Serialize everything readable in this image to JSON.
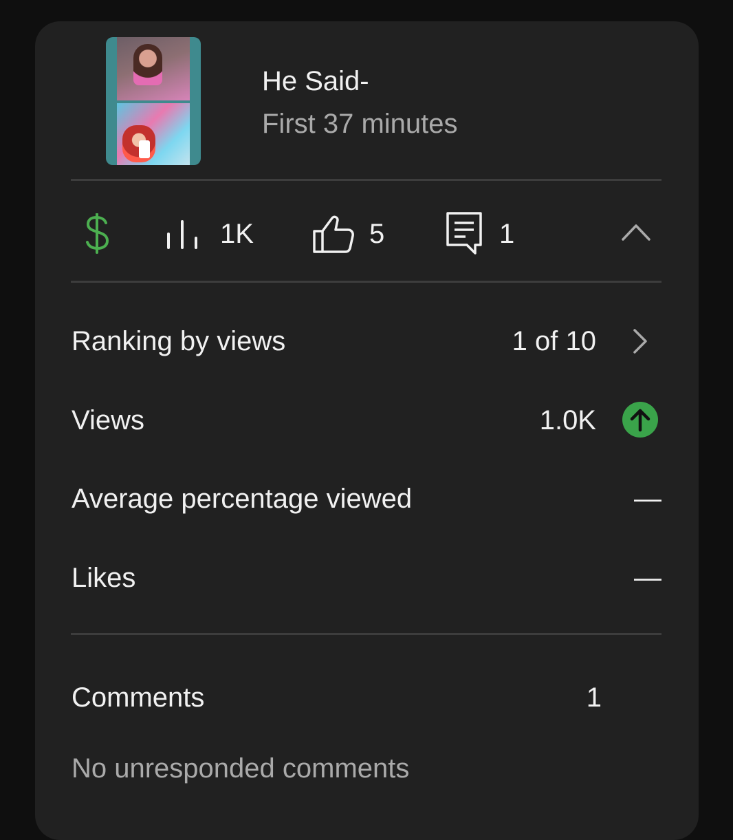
{
  "video": {
    "title": "He Said-",
    "subtitle": "First 37 minutes"
  },
  "stats": {
    "views": "1K",
    "likes": "5",
    "comments": "1"
  },
  "metrics": [
    {
      "label": "Ranking by views",
      "value": "1 of 10"
    },
    {
      "label": "Views",
      "value": "1.0K"
    },
    {
      "label": "Average percentage viewed",
      "value": "—"
    },
    {
      "label": "Likes",
      "value": "—"
    }
  ],
  "comments_section": {
    "label": "Comments",
    "value": "1",
    "note": "No unresponded comments"
  },
  "colors": {
    "background": "#0f0f0f",
    "card": "#212121",
    "divider": "#3d3d3d",
    "text": "#f1f1f1",
    "muted": "#aaaaaa",
    "monetization_green": "#4caf50",
    "trend_up_green": "#3aa34a"
  },
  "icons": {
    "monetization": "dollar-icon",
    "views": "bar-chart-icon",
    "likes": "thumbs-up-icon",
    "comments": "comment-icon",
    "collapse": "chevron-up-icon",
    "ranking_details": "chevron-right-icon",
    "views_trend": "arrow-up-circle-icon"
  }
}
